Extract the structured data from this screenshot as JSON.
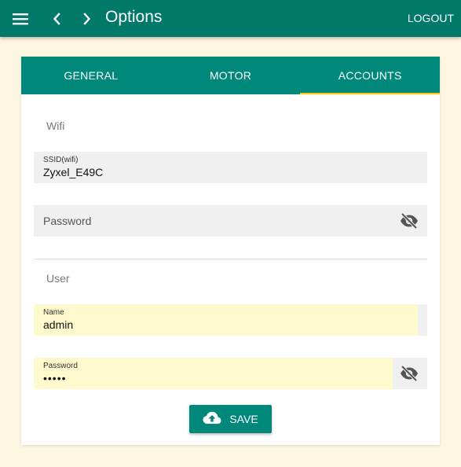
{
  "appbar": {
    "title": "Options",
    "logout_label": "LOGOUT",
    "icons": {
      "menu": "menu-icon",
      "back": "chevron-left-icon",
      "forward": "chevron-right-icon"
    }
  },
  "tabs": [
    {
      "label": "GENERAL",
      "active": false
    },
    {
      "label": "MOTOR",
      "active": false
    },
    {
      "label": "ACCOUNTS",
      "active": true
    }
  ],
  "wifi": {
    "section_label": "Wifi",
    "ssid": {
      "label": "SSID(wifi)",
      "value": "Zyxel_E49C"
    },
    "password": {
      "placeholder": "Password",
      "icon": "visibility-off-icon"
    }
  },
  "user": {
    "section_label": "User",
    "name": {
      "label": "Name",
      "value": "admin"
    },
    "password": {
      "label": "Password",
      "value": "•••••",
      "icon": "visibility-off-icon"
    }
  },
  "save_button": {
    "label": "SAVE",
    "icon": "cloud-upload-icon"
  },
  "colors": {
    "primary": "#00796b",
    "tabs": "#00897b",
    "accent": "#ffc400",
    "background": "#fdf6e0",
    "autofill": "#fefacd"
  }
}
